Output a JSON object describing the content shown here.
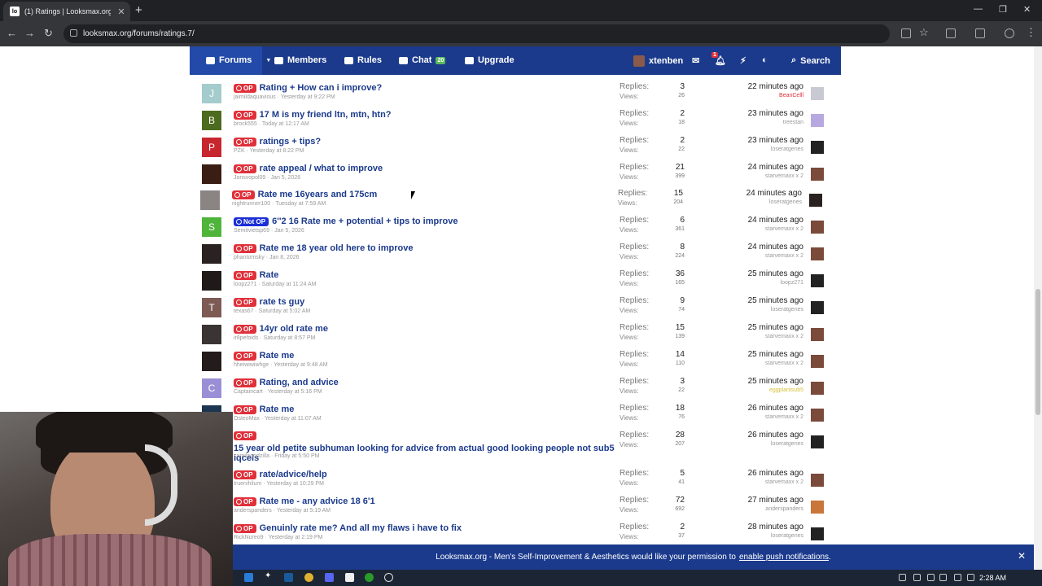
{
  "browser": {
    "tab_title": "(1) Ratings | Looksmax.org - M...",
    "favicon": "lo",
    "url": "looksmax.org/forums/ratings.7/"
  },
  "forum_nav": {
    "forums": "Forums",
    "members": "Members",
    "rules": "Rules",
    "chat": "Chat",
    "chat_badge": "20",
    "upgrade": "Upgrade",
    "username": "xtenben",
    "alert_count": "1",
    "search": "Search"
  },
  "labels": {
    "replies": "Replies:",
    "views": "Views:",
    "op": "OP",
    "not_op": "Not OP"
  },
  "threads": [
    {
      "avatar": "J",
      "avatar_color": "#a4cccc",
      "op": "OP",
      "title": "Rating + How can i improve?",
      "author": "jaimildaquavious",
      "date": "Yesterday at 9:22 PM",
      "replies": "3",
      "views": "26",
      "time": "22 minutes ago",
      "last_user": "BeanCelll",
      "last_user_color": "#e0303a"
    },
    {
      "avatar": "B",
      "avatar_color": "#4c6b1f",
      "op": "OP",
      "title": "17 M is my friend ltn, mtn, htn?",
      "author": "brock555",
      "date": "Today at 12:17 AM",
      "replies": "2",
      "views": "18",
      "time": "23 minutes ago",
      "last_user": "treestan",
      "last_user_color": "#999"
    },
    {
      "avatar": "P",
      "avatar_color": "#c8262e",
      "op": "OP",
      "title": "ratings + tips?",
      "author": "PZK",
      "date": "Yesterday at 8:22 PM",
      "replies": "2",
      "views": "22",
      "time": "23 minutes ago",
      "last_user": "loseratgenes",
      "last_user_color": "#999"
    },
    {
      "avatar": "",
      "avatar_color": "#3a1e14",
      "op": "OP",
      "title": "rate appeal / what to improve",
      "author": "Jonsvopol09",
      "date": "Jan 5, 2026",
      "replies": "21",
      "views": "399",
      "time": "24 minutes ago",
      "last_user": "starvemaxx x 2",
      "last_user_color": "#999"
    },
    {
      "avatar": "",
      "avatar_color": "#8a8583",
      "op": "OP",
      "title": "Rate me 16years and 175cm",
      "author": "nightrunner100",
      "date": "Tuesday at 7:59 AM",
      "replies": "15",
      "views": "204",
      "time": "24 minutes ago",
      "last_user": "loseratgenes",
      "last_user_color": "#999"
    },
    {
      "avatar": "S",
      "avatar_color": "#4fb53a",
      "op": "Not OP",
      "title": "6''2 16 Rate me + potential + tips to improve",
      "author": "Semitvietsp69",
      "date": "Jan 5, 2026",
      "replies": "6",
      "views": "361",
      "time": "24 minutes ago",
      "last_user": "starvemaxx x 2",
      "last_user_color": "#999"
    },
    {
      "avatar": "",
      "avatar_color": "#2a2220",
      "op": "OP",
      "title": "Rate me 18 year old here to improve",
      "author": "phantomsky",
      "date": "Jan 8, 2026",
      "replies": "8",
      "views": "224",
      "time": "24 minutes ago",
      "last_user": "starvemaxx x 2",
      "last_user_color": "#999"
    },
    {
      "avatar": "",
      "avatar_color": "#1f1a18",
      "op": "OP",
      "title": "Rate",
      "author": "loopz271",
      "date": "Saturday at 11:24 AM",
      "replies": "36",
      "views": "165",
      "time": "25 minutes ago",
      "last_user": "loopz271",
      "last_user_color": "#999"
    },
    {
      "avatar": "T",
      "avatar_color": "#7d5a54",
      "op": "OP",
      "title": "rate ts guy",
      "author": "texas67",
      "date": "Saturday at 5:02 AM",
      "replies": "9",
      "views": "74",
      "time": "25 minutes ago",
      "last_user": "loseratgenes",
      "last_user_color": "#999"
    },
    {
      "avatar": "",
      "avatar_color": "#3a3533",
      "op": "OP",
      "title": "14yr old rate me",
      "author": "ir8pefoids",
      "date": "Saturday at 8:57 PM",
      "replies": "15",
      "views": "139",
      "time": "25 minutes ago",
      "last_user": "starvemaxx x 2",
      "last_user_color": "#999"
    },
    {
      "avatar": "",
      "avatar_color": "#231c1a",
      "op": "OP",
      "title": "Rate me",
      "author": "hheiwiwiwhge",
      "date": "Yesterday at 9:48 AM",
      "replies": "14",
      "views": "110",
      "time": "25 minutes ago",
      "last_user": "starvemaxx x 2",
      "last_user_color": "#999"
    },
    {
      "avatar": "C",
      "avatar_color": "#9a8fd6",
      "op": "OP",
      "title": "Rating, and advice",
      "author": "Captaincart",
      "date": "Yesterday at 5:16 PM",
      "replies": "3",
      "views": "22",
      "time": "25 minutes ago",
      "last_user": "eggplantsub5",
      "last_user_color": "#d4c23a"
    },
    {
      "avatar": "",
      "avatar_color": "#1c3550",
      "op": "OP",
      "title": "Rate me",
      "author": "OsteoMax",
      "date": "Yesterday at 11:07 AM",
      "replies": "18",
      "views": "76",
      "time": "26 minutes ago",
      "last_user": "starvemaxx x 2",
      "last_user_color": "#999"
    },
    {
      "avatar": "",
      "avatar_color": "#2e2a28",
      "op": "OP",
      "title": "15 year old petite subhuman looking for advice from actual good looking people not sub5 iqcels",
      "author": "camilagodzilla",
      "date": "Friday at 5:50 PM",
      "replies": "28",
      "views": "207",
      "time": "26 minutes ago",
      "last_user": "loseratgenes",
      "last_user_color": "#999"
    },
    {
      "avatar": "",
      "avatar_color": "#2e2a28",
      "op": "OP",
      "title": "rate/advice/help",
      "author": "truenihilum",
      "date": "Yesterday at 10:29 PM",
      "replies": "5",
      "views": "41",
      "time": "26 minutes ago",
      "last_user": "starvemaxx x 2",
      "last_user_color": "#999"
    },
    {
      "avatar": "",
      "avatar_color": "#2e2a28",
      "op": "OP",
      "title": "Rate me - any advice 18 6'1",
      "author": "anderspanders",
      "date": "Yesterday at 5:19 AM",
      "replies": "72",
      "views": "692",
      "time": "27 minutes ago",
      "last_user": "anderspanders",
      "last_user_color": "#999"
    },
    {
      "avatar": "",
      "avatar_color": "#2e2a28",
      "op": "OP",
      "title": "Genuinly rate me? And all my flaws i have to fix",
      "author": "RickNureo9",
      "date": "Yesterday at 2:19 PM",
      "replies": "2",
      "views": "37",
      "time": "28 minutes ago",
      "last_user": "loseratgenes",
      "last_user_color": "#999"
    }
  ],
  "last_avatars": [
    "#c9c9d4",
    "#b8a8e0",
    "#222",
    "#7a4a3a",
    "#2a2220",
    "#7a4a3a",
    "#7a4a3a",
    "#222",
    "#222",
    "#7a4a3a",
    "#7a4a3a",
    "#7a4a3a",
    "#7a4a3a",
    "#222",
    "#7a4a3a",
    "#c8763a",
    "#222"
  ],
  "notice": {
    "text": "Looksmax.org - Men's Self-Improvement & Aesthetics would like your permission to",
    "link": "enable push notifications",
    "period": "."
  },
  "taskbar": {
    "time": "2:28 AM"
  }
}
